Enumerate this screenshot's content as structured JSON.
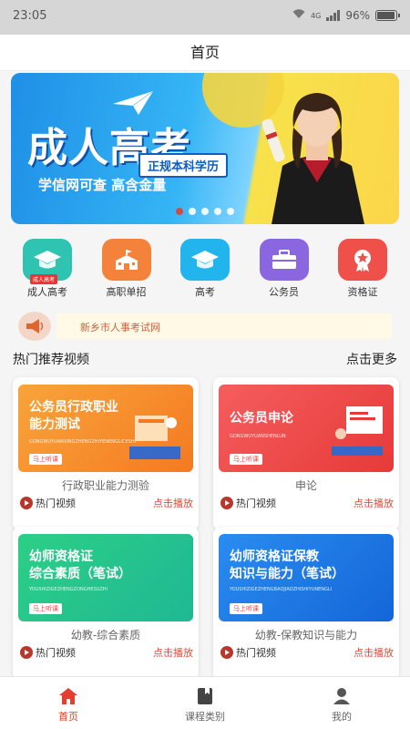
{
  "status": {
    "time": "23:05",
    "network": "4G",
    "battery": "96%",
    "battery_level": 0.96
  },
  "header": {
    "title": "首页"
  },
  "banner": {
    "title": "成人高考",
    "tag": "正规本科学历",
    "subtitle": "学信网可查 高含金量",
    "slide_count": 5,
    "active_slide": 1
  },
  "categories": [
    {
      "label": "成人高考",
      "icon": "graduation-cap-icon",
      "color": "#2fc4b2",
      "badge": "成人高考"
    },
    {
      "label": "高职单招",
      "icon": "school-building-icon",
      "color": "#f5823b"
    },
    {
      "label": "高考",
      "icon": "graduation-cap-icon",
      "color": "#22b4ec"
    },
    {
      "label": "公务员",
      "icon": "briefcase-icon",
      "color": "#8a67e0"
    },
    {
      "label": "资格证",
      "icon": "certificate-badge-icon",
      "color": "#f0504a"
    }
  ],
  "notice": {
    "text": "新乡市人事考试网"
  },
  "section": {
    "title": "热门推荐视频",
    "more": "点击更多"
  },
  "videos": [
    {
      "thumb_title": "公务员行政职业\n能力测试",
      "thumb_sub": "GONGWUYUANXINGZHENGZHIYENENGLICESHI",
      "thumb_btn": "马上听课",
      "name": "行政职业能力测验",
      "hot": "热门视频",
      "play": "点击播放",
      "bg": "#f7932e"
    },
    {
      "thumb_title": "公务员申论",
      "thumb_sub": "GONGWUYUANSHENLUN",
      "thumb_btn": "马上听课",
      "name": "申论",
      "hot": "热门视频",
      "play": "点击播放",
      "bg": "#ef4a4a"
    },
    {
      "thumb_title": "幼师资格证\n综合素质（笔试）",
      "thumb_sub": "YOUSHIZIGEZHENGZONGHESUZHI",
      "thumb_btn": "马上听课",
      "name": "幼教-综合素质",
      "hot": "热门视频",
      "play": "点击播放",
      "bg": "#27c38a"
    },
    {
      "thumb_title": "幼师资格证保教\n知识与能力（笔试）",
      "thumb_sub": "YOUSHIZIGEZHENGBAOJIAOZHISHIYUNENGLI",
      "thumb_btn": "马上听课",
      "name": "幼教-保教知识与能力",
      "hot": "热门视频",
      "play": "点击播放",
      "bg": "#1f7fe8"
    }
  ],
  "tabbar": [
    {
      "label": "首页",
      "icon": "home-icon",
      "active": true
    },
    {
      "label": "课程类别",
      "icon": "book-icon",
      "active": false
    },
    {
      "label": "我的",
      "icon": "user-icon",
      "active": false
    }
  ],
  "colors": {
    "accent": "#e0402f",
    "tab_active": "#e0402f"
  }
}
